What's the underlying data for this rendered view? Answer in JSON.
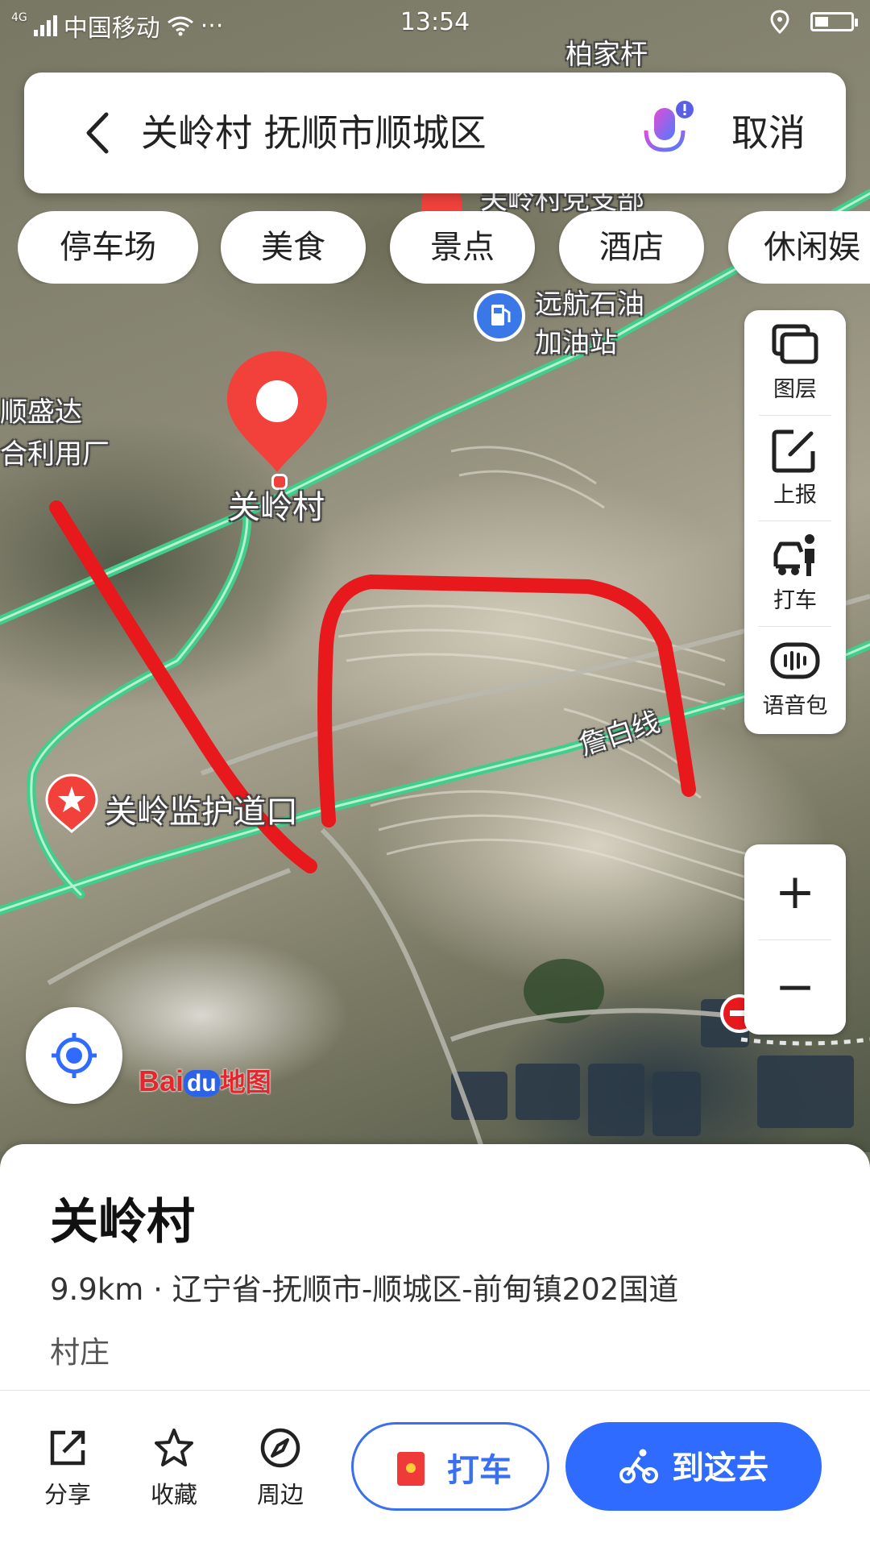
{
  "status_bar": {
    "network": "4G",
    "carrier": "中国移动",
    "more": "···",
    "time": "13:54"
  },
  "search": {
    "back_icon": "chevron-left-icon",
    "query": "关岭村 抚顺市顺城区",
    "mic_icon": "microphone-icon",
    "cancel_label": "取消"
  },
  "categories": [
    "停车场",
    "美食",
    "景点",
    "酒店",
    "休闲娱"
  ],
  "map_labels": {
    "village_top": "柏家杆",
    "village_dept": "关岭村党支部",
    "gas_station_line1": "远航石油",
    "gas_station_line2": "加油站",
    "factory_line1": "顺盛达",
    "factory_line2": "合利用厂",
    "pin_label": "关岭村",
    "checkpoint": "关岭监护道口",
    "road_name": "詹白线"
  },
  "tools": [
    {
      "icon": "layers-icon",
      "label": "图层"
    },
    {
      "icon": "report-icon",
      "label": "上报"
    },
    {
      "icon": "taxi-icon",
      "label": "打车"
    },
    {
      "icon": "voice-pack-icon",
      "label": "语音包"
    }
  ],
  "zoom": {
    "in": "+",
    "out": "−"
  },
  "logo": {
    "part1": "Bai",
    "part2": "du",
    "part3": "地图"
  },
  "place": {
    "name": "关岭村",
    "info": "9.9km · 辽宁省-抚顺市-顺城区-前甸镇202国道",
    "type": "村庄"
  },
  "actions": [
    {
      "icon": "share-icon",
      "label": "分享"
    },
    {
      "icon": "star-icon",
      "label": "收藏"
    },
    {
      "icon": "compass-icon",
      "label": "周边"
    }
  ],
  "buttons": {
    "taxi": "打车",
    "go": "到这去"
  },
  "colors": {
    "road": "#4ed69a",
    "route_mark": "#e8191c",
    "pin": "#f2413b",
    "accent": "#2f6bff"
  }
}
